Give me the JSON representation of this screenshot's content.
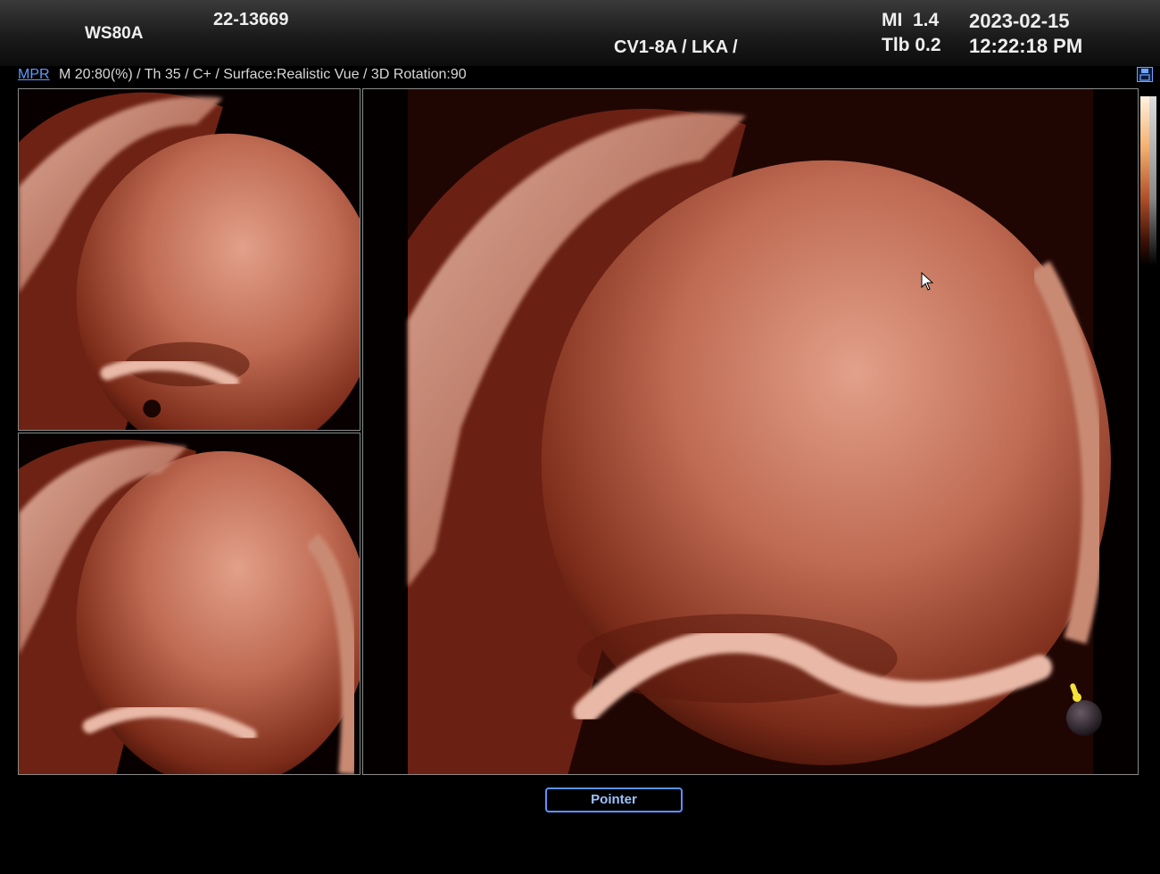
{
  "header": {
    "system_name": "WS80A",
    "patient_id": "22-13669",
    "probe_preset": "CV1-8A / LKA /",
    "mi_label": "MI",
    "mi_value": "1.4",
    "tib_label": "Tlb",
    "tib_value": "0.2",
    "date": "2023-02-15",
    "time": "12:22:18 PM"
  },
  "info_bar": {
    "mode_link": "MPR",
    "parameters": "M 20:80(%) / Th 35 / C+ / Surface:Realistic Vue / 3D Rotation:90"
  },
  "icons": {
    "save": "save-icon",
    "cursor": "mouse-cursor-icon",
    "orientation": "orientation-marker-icon"
  },
  "colors": {
    "accent": "#5c92ff",
    "render_tissue": "#b5553e"
  },
  "footer": {
    "pointer_button": "Pointer"
  }
}
